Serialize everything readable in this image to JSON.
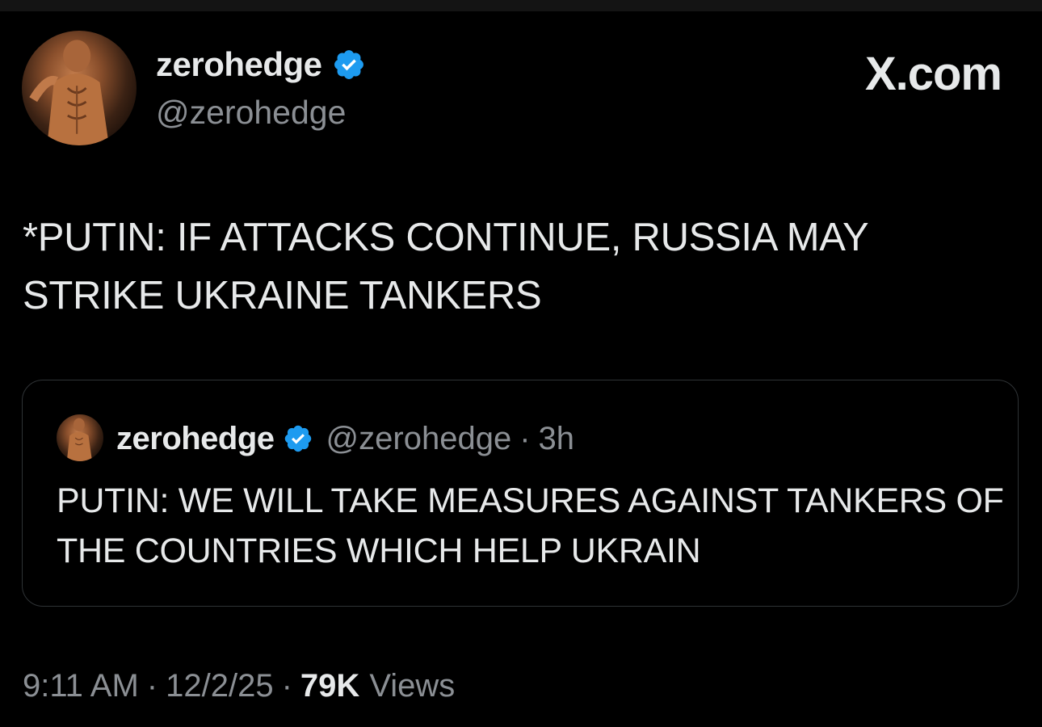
{
  "author": {
    "display_name": "zerohedge",
    "handle": "@zerohedge",
    "verified": true
  },
  "brand": "X.com",
  "tweet": {
    "text": "*PUTIN: IF ATTACKS CONTINUE, RUSSIA MAY STRIKE UKRAINE TANKERS"
  },
  "quoted_tweet": {
    "display_name": "zerohedge",
    "handle": "@zerohedge",
    "separator": "·",
    "time": "3h",
    "text": "PUTIN: WE WILL TAKE MEASURES AGAINST TANKERS OF THE COUNTRIES WHICH HELP UKRAIN"
  },
  "footer": {
    "time": "9:11 AM",
    "date": "12/2/25",
    "views_count": "79K",
    "views_label": "Views",
    "separator": "·"
  },
  "colors": {
    "background": "#000000",
    "text": "#e7e9ea",
    "muted": "#8b8f94",
    "verified": "#1d9bf0",
    "border": "#2f3336"
  },
  "icons": {
    "verified": "verified-badge-icon"
  }
}
